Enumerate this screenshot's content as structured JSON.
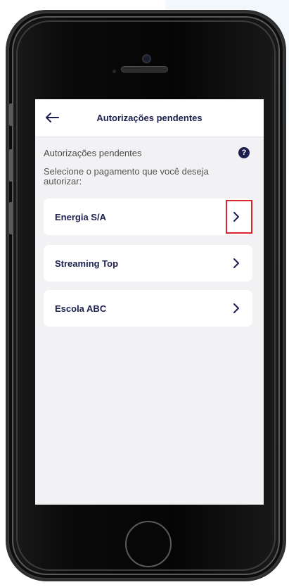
{
  "header": {
    "back_icon": "arrow-left-icon",
    "title": "Autorizações pendentes"
  },
  "section": {
    "title": "Autorizações pendentes",
    "help_icon": "question-circle-icon",
    "help_glyph": "?",
    "instruction": "Selecione o pagamento que você deseja autorizar:"
  },
  "payments": [
    {
      "label": "Energia S/A",
      "icon": "chevron-right-icon",
      "highlighted": true
    },
    {
      "label": "Streaming Top",
      "icon": "chevron-right-icon",
      "highlighted": false
    },
    {
      "label": "Escola ABC",
      "icon": "chevron-right-icon",
      "highlighted": false
    }
  ],
  "colors": {
    "primary": "#1c1f4e",
    "highlight": "#d9262e",
    "screen_background": "#f2f2f5",
    "card_background": "#ffffff"
  }
}
